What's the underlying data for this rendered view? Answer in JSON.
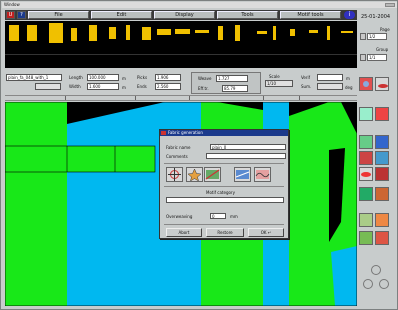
{
  "window": {
    "title": "Window"
  },
  "menu": {
    "file": "File",
    "edit": "Edit",
    "display": "Display",
    "tools": "Tools",
    "motif_tools": "Motif tools",
    "info_icon": "info-icon"
  },
  "date": "25-01-2004",
  "right_panel": {
    "page_label": "Page",
    "page_value": "1/2",
    "group_label": "Group",
    "group_value": "1/1"
  },
  "params": {
    "name_value": "plain_fa_048_with_1",
    "length_label": "Length",
    "length_value": "100.000",
    "length_unit": "m",
    "width_label": "Width",
    "width_value": "1.600",
    "width_unit": "m",
    "picks_label": "Picks",
    "picks_value": "1.906",
    "ends_label": "Ends",
    "ends_value": "2.560",
    "weave_label": "Weave",
    "weave_value": "1.727",
    "eff_label": "Eff.tr.",
    "eff_value": "85.79",
    "scale_label": "Scale",
    "scale_value": "1/10",
    "verif_label": "Verif",
    "sum_label": "Sum.",
    "unit_m": "m",
    "unit_deg": "deg"
  },
  "colors": {
    "green": "#18e818",
    "cyan": "#00b8f0",
    "black": "#000000",
    "motif": "#f0c000",
    "title_blue": "#1c3a8c"
  },
  "dialog": {
    "title": "Fabric generation",
    "fabric_name_label": "Fabric name",
    "fabric_name_value": "plain_0",
    "comments_label": "Comments",
    "comments_value": "",
    "motif_category_label": "Motif category",
    "overweaving_label": "Overweaving",
    "overweaving_value": "0",
    "overweaving_unit": "mm",
    "abort_label": "Abort",
    "restore_label": "Restore",
    "ok_label": "OK"
  }
}
